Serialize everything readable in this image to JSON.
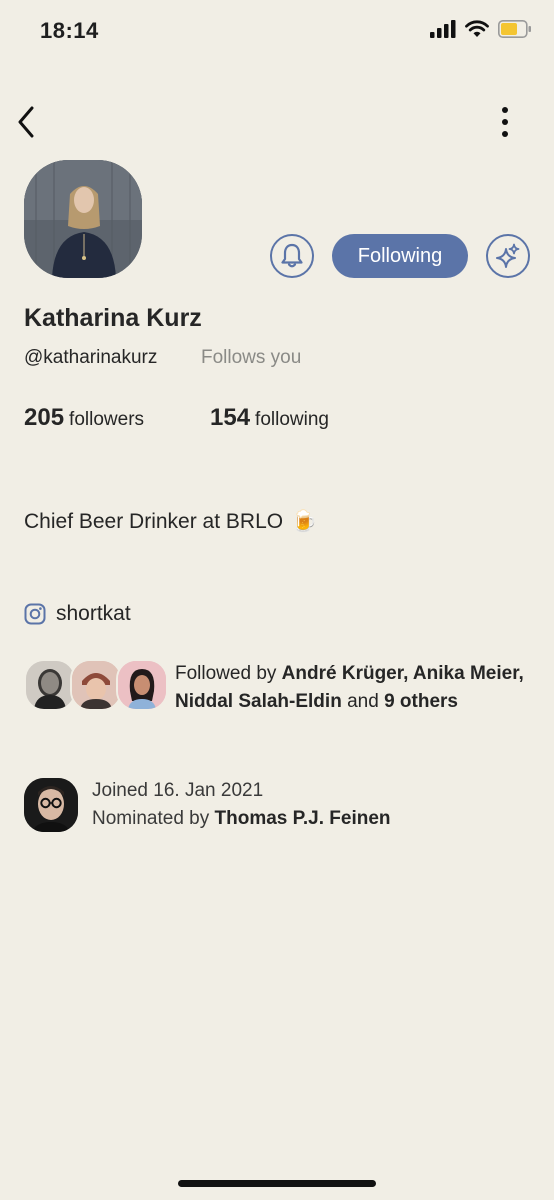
{
  "status_bar": {
    "time": "18:14",
    "battery_color": "#f4c531"
  },
  "nav": {
    "back_icon": "chevron-left-icon",
    "more_icon": "more-vertical-icon"
  },
  "profile": {
    "name": "Katharina Kurz",
    "handle": "@katharinakurz",
    "follows_you": "Follows you",
    "followers_count": "205",
    "followers_label": "followers",
    "following_count": "154",
    "following_label": "following",
    "bio": "Chief Beer Drinker at BRLO",
    "bio_emoji": "🍺",
    "instagram": "shortkat"
  },
  "actions": {
    "bell_icon": "bell-icon",
    "following_label": "Following",
    "sparkle_icon": "sparkle-icon",
    "accent_color": "#5b74a8"
  },
  "followed_by": {
    "prefix": "Followed by",
    "names": "André Krüger, Anika Meier, Niddal Salah-Eldin",
    "and_word": "and",
    "others": "9 others"
  },
  "joined": {
    "date_text": "Joined 16. Jan 2021",
    "nominated_prefix": "Nominated by",
    "nominator": "Thomas P.J. Feinen"
  }
}
